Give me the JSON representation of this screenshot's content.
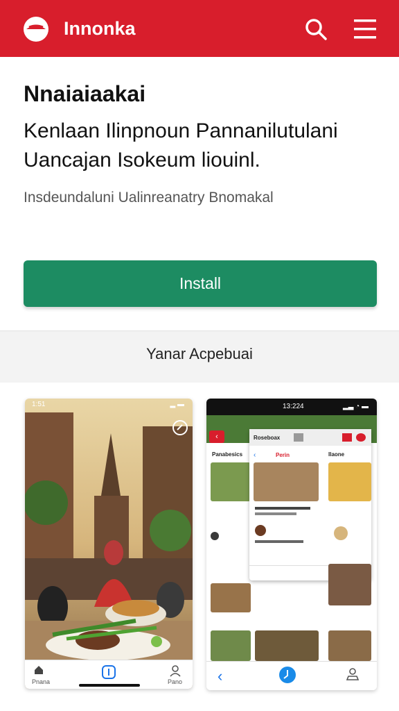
{
  "header": {
    "brand": "Innonka",
    "icons": [
      "logo-icon",
      "search-icon",
      "menu-icon"
    ],
    "color": "#d81e2c"
  },
  "app": {
    "title": "Nnaiaiaakai",
    "description": "Kenlaan Ilinpnoun Pannanilutulani Uancajan Isokeum liouinl.",
    "subtitle": "Insdeundaluni Ualinreanatry Bnomakal",
    "install_label": "Install",
    "install_color": "#1d8c62"
  },
  "section": {
    "title": "Yanar Acpebuai"
  },
  "screenshot_left": {
    "status_time": "1:51",
    "nav_left": "Pnana",
    "nav_right": "Pano"
  },
  "screenshot_right": {
    "status_time": "13:224",
    "col1_header": "Panabesics",
    "overlay_header": "Roseboax",
    "overlay_tab": "Perin",
    "col3_header": "Ilaone"
  }
}
